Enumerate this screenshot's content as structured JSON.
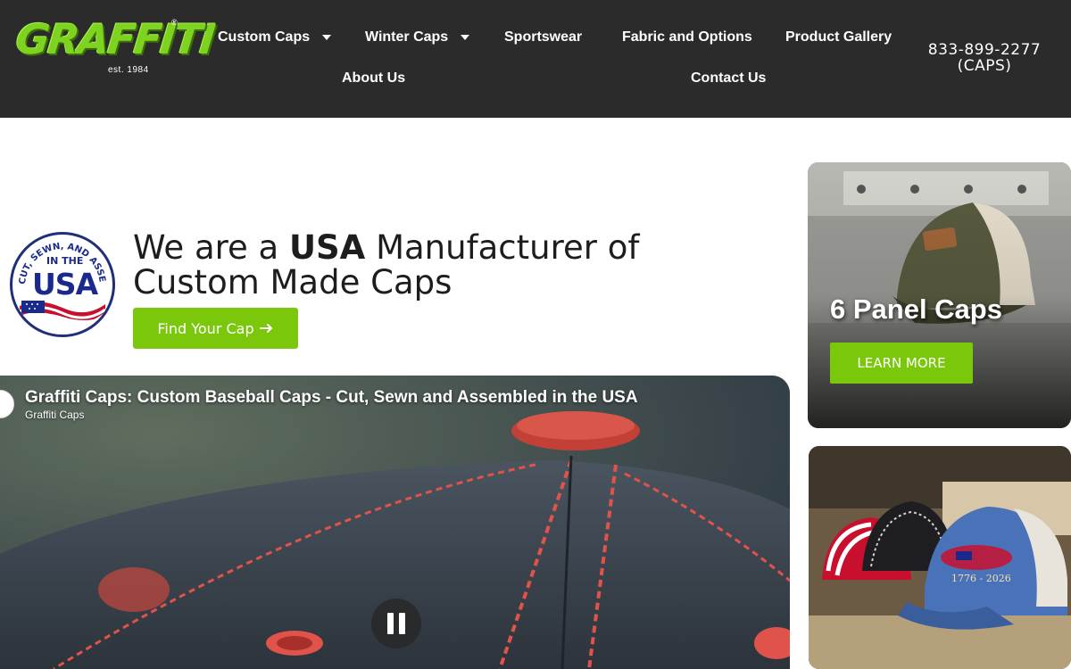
{
  "brand": {
    "logo_text": "GRAFFITI",
    "registered": "®",
    "established": "est. 1984"
  },
  "nav": {
    "items": [
      {
        "label": "Custom Caps",
        "dropdown": true
      },
      {
        "label": "Winter Caps",
        "dropdown": true
      },
      {
        "label": "Sportswear",
        "dropdown": false
      },
      {
        "label": "Fabric and Options",
        "dropdown": false
      },
      {
        "label": "Product Gallery",
        "dropdown": false
      },
      {
        "label": "About Us",
        "dropdown": false
      },
      {
        "label": "Contact Us",
        "dropdown": false
      }
    ],
    "phone_line1": "833-899-2277",
    "phone_line2": "(CAPS)"
  },
  "hero": {
    "badge_top": "CUT, SEWN, AND ASSEMBLED",
    "badge_in_the": "IN THE",
    "badge_usa": "USA",
    "title_prefix": "We are a ",
    "title_bold": "USA",
    "title_suffix": " Manufacturer of Custom Made Caps",
    "cta_label": "Find Your Cap",
    "cta_icon": "arrow-right-icon"
  },
  "video": {
    "title": "Graffiti Caps: Custom Baseball Caps - Cut, Sewn and Assembled in the USA",
    "channel": "Graffiti Caps",
    "state": "playing"
  },
  "cards": [
    {
      "title": "6 Panel Caps",
      "button": "LEARN MORE"
    },
    {
      "title": "",
      "button": ""
    }
  ],
  "colors": {
    "header_bg": "#2b2b2b",
    "accent_green": "#7ac70c",
    "logo_green": "#7ed321",
    "badge_blue": "#1a2a8c"
  }
}
